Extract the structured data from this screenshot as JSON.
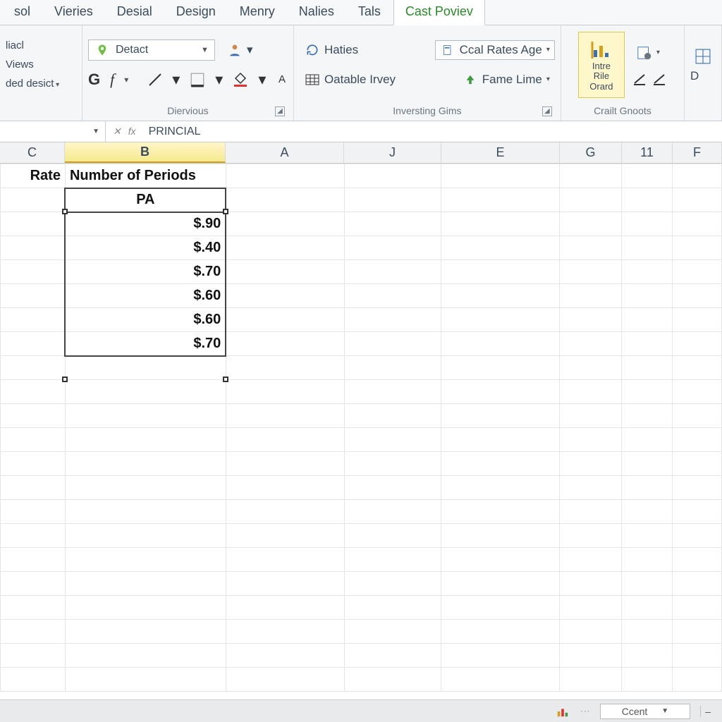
{
  "tabs": [
    "sol",
    "Vieries",
    "Desial",
    "Design",
    "Menry",
    "Nalies",
    "Tals",
    "Cast Poviev"
  ],
  "active_tab_index": 7,
  "ribbon": {
    "group1": {
      "items": [
        "liacl",
        "Views",
        "ded desict"
      ]
    },
    "group2": {
      "combo": "Detact",
      "bold": "G",
      "italic": "f",
      "label": "Diervious"
    },
    "group3": {
      "haties": "Haties",
      "oatable": "Oatable Irvey",
      "ccal": "Ccal Rates Age",
      "fame": "Fame Lime",
      "label": "Inversting Gims"
    },
    "group4": {
      "intre": "Intre Rile Orard",
      "label": "Crailt Gnoots"
    },
    "group5": {
      "d": "D"
    }
  },
  "formula_bar": {
    "namebox": "",
    "formula": "PRINCIAL"
  },
  "columns": [
    "C",
    "B",
    "A",
    "J",
    "E",
    "G",
    "11",
    "F"
  ],
  "selected_col_index": 1,
  "grid": {
    "c_header": "Rate",
    "b_header": "Number of Periods",
    "b_sub": "PA",
    "b_values": [
      "$.90",
      "$.40",
      "$.70",
      "$.60",
      "$.60",
      "$.70"
    ]
  },
  "statusbar": {
    "zoom_label": "Ccent"
  },
  "colors": {
    "accent_green": "#2a8a2a",
    "highlight_yellow": "#fff7cc"
  }
}
